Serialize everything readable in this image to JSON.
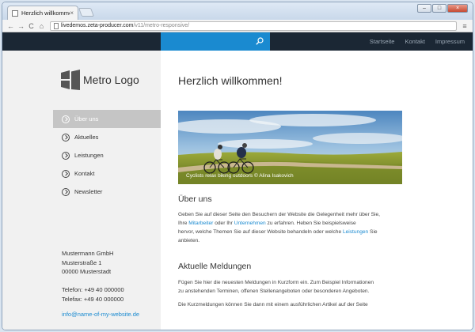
{
  "browser": {
    "tab_title": "Herzlich willkommen!",
    "tab_close": "×",
    "url_host": "livedemos.zeta-producer.com",
    "url_path": "/v11/metro-responsive/",
    "nav_back": "←",
    "nav_forward": "→",
    "nav_reload": "C",
    "nav_home": "⌂",
    "menu": "≡",
    "window_controls": {
      "minimize": "–",
      "maximize": "□",
      "close": "×"
    }
  },
  "site": {
    "colors": {
      "accent": "#1a8ad0",
      "nav_bg": "#1b2734",
      "active_bg": "#c5c5c5"
    },
    "topnav": {
      "links": [
        "Startseite",
        "Kontakt",
        "Impressum"
      ]
    },
    "logo": {
      "text": "Metro Logo"
    },
    "menu": [
      {
        "label": "Über uns",
        "active": true
      },
      {
        "label": "Aktuelles",
        "active": false
      },
      {
        "label": "Leistungen",
        "active": false
      },
      {
        "label": "Kontakt",
        "active": false
      },
      {
        "label": "Newsletter",
        "active": false
      }
    ],
    "address": {
      "company": "Mustermann GmbH",
      "street": "Musterstraße 1",
      "city": "00000 Musterstadt",
      "phone": "Telefon: +49 40 000000",
      "fax": "Telefax: +49 40 000000",
      "email": "info@name-of-my-website.de"
    },
    "content": {
      "title": "Herzlich willkommen!",
      "hero_caption": "Cyclists relax biking outdoors © Alina Isakovich",
      "about": {
        "heading": "Über uns",
        "text_1": "Geben Sie auf dieser Seite den Besuchern der Website die Gelegenheit mehr über Sie,",
        "text_2a": "Ihre ",
        "link_1": "Mitarbeiter",
        "text_2b": " oder Ihr ",
        "link_2": "Unternehmen",
        "text_2c": " zu erfahren. Heben Sie beispielsweise",
        "text_3a": "hervor, welche Themen Sie auf dieser Website behandeln oder welche ",
        "link_3": "Leistungen",
        "text_3b": " Sie",
        "text_4": "anbieten."
      },
      "news": {
        "heading": "Aktuelle Meldungen",
        "text_1": "Fügen Sie hier die neuesten Meldungen in Kurzform ein. Zum Beispiel Informationen",
        "text_2": "zu anstehenden Terminen, offenen Stellenangeboten oder besonderen Angeboten.",
        "text_3": "Die Kurzmeldungen können Sie dann mit einem ausführlichen Artikel auf der Seite"
      }
    }
  }
}
